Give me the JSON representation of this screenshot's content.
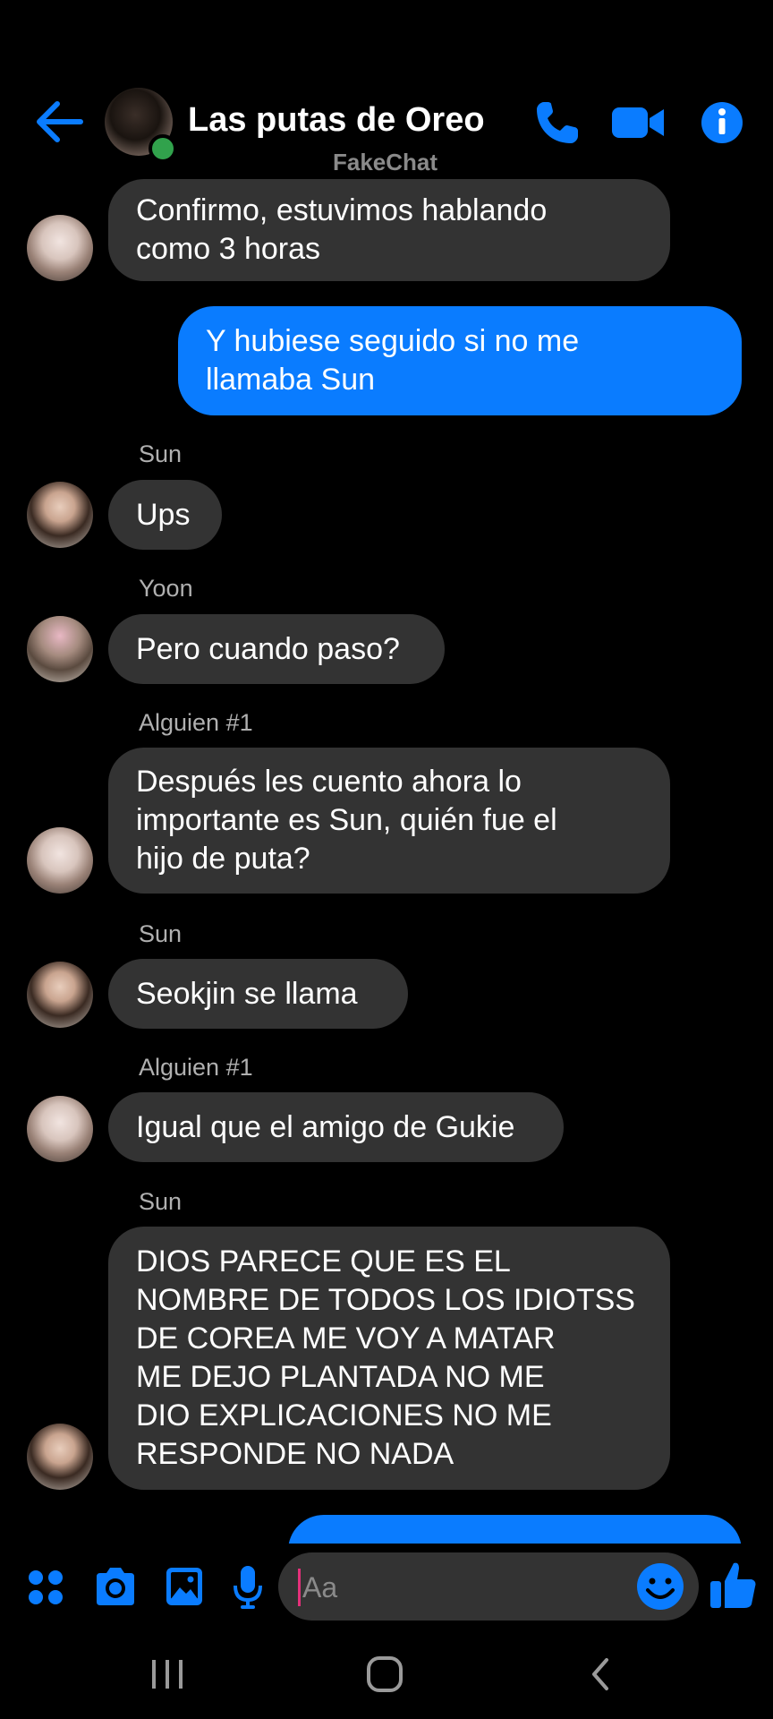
{
  "header": {
    "title": "Las putas de Oreo",
    "watermark": "FakeChat"
  },
  "messages": [
    {
      "type": "received",
      "sender": "",
      "text": "Confirmo, estuvimos hablando\ncomo 3 horas"
    },
    {
      "type": "sent",
      "text": "Y hubiese seguido si no me\nllamaba Sun"
    },
    {
      "type": "received",
      "sender": "Sun",
      "text": "Ups"
    },
    {
      "type": "received",
      "sender": "Yoon",
      "text": "Pero cuando paso?"
    },
    {
      "type": "received",
      "sender": "Alguien #1",
      "text": "Después les cuento ahora lo\nimportante es Sun, quién fue el\nhijo de puta?"
    },
    {
      "type": "received",
      "sender": "Sun",
      "text": "Seokjin se llama"
    },
    {
      "type": "received",
      "sender": "Alguien #1",
      "text": "Igual que el amigo de Gukie"
    },
    {
      "type": "received",
      "sender": "Sun",
      "text": "DIOS PARECE QUE ES EL\nNOMBRE DE TODOS LOS IDIOTSS\nDE COREA ME VOY A MATAR\nME DEJO PLANTADA NO ME\nDIO EXPLICACIONES NO ME\nRESPONDE NO NADA"
    }
  ],
  "composer": {
    "placeholder": "Aa"
  },
  "colors": {
    "accent": "#0a7cff",
    "received_bubble": "#333333",
    "online": "#31a24c",
    "cursor": "#e4307a"
  },
  "icons": [
    "back-arrow-icon",
    "phone-icon",
    "video-camera-icon",
    "info-icon",
    "menu-grid-icon",
    "camera-icon",
    "image-icon",
    "microphone-icon",
    "emoji-icon",
    "thumbs-up-icon",
    "recent-apps-icon",
    "home-icon",
    "nav-back-icon"
  ]
}
